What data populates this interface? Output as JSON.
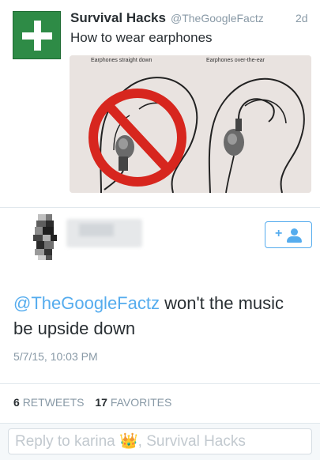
{
  "tweet": {
    "author_name": "Survival Hacks",
    "author_handle": "@TheGoogleFactz",
    "time": "2d",
    "text": "How to wear earphones",
    "media": {
      "left_label": "Earphones straight down",
      "right_label": "Earphones over-the-ear"
    }
  },
  "reply": {
    "mention": "@TheGoogleFactz",
    "text": " won't the music be upside down",
    "date": "5/7/15, 10:03 PM",
    "stats": {
      "retweets_count": "6",
      "retweets_label": "RETWEETS",
      "favorites_count": "17",
      "favorites_label": "FAVORITES"
    }
  },
  "reply_bar": {
    "placeholder": "Reply to karina 👑, Survival Hacks"
  },
  "colors": {
    "brand_blue": "#55acee",
    "avatar_green": "#2e8b46",
    "no_sign_red": "#d7261e"
  }
}
